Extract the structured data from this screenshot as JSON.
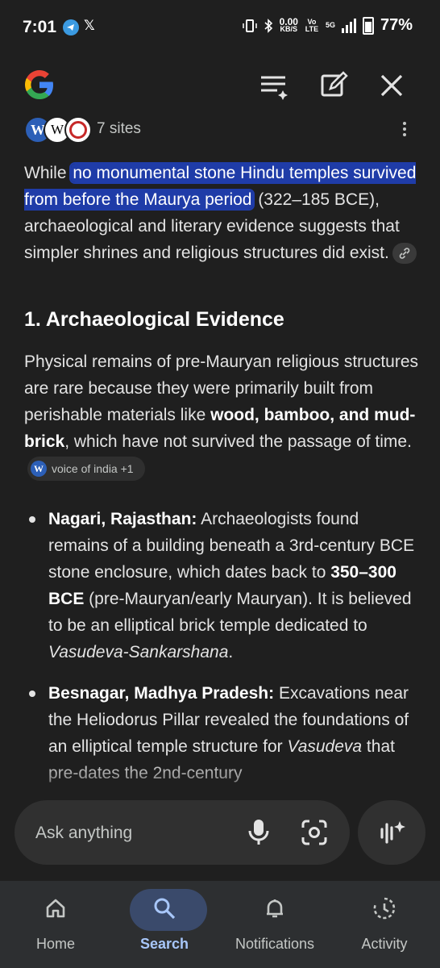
{
  "status_bar": {
    "time": "7:01",
    "network_speed": "0.00",
    "network_unit": "KB/S",
    "volte": "Vo LTE",
    "signal": "5G",
    "battery": "77%"
  },
  "sources": {
    "count_label": "7 sites",
    "favicons": [
      "W",
      "W",
      "ring"
    ]
  },
  "answer": {
    "intro_before": "While ",
    "intro_highlight": "no monumental stone Hindu temples survived from before the Maurya period",
    "intro_after": " (322–185 BCE), archaeological and literary evidence suggests that simpler shrines and religious structures did exist.",
    "section1_heading": "1. Archaeological Evidence",
    "section1_p_before": "Physical remains of pre-Mauryan religious structures are rare because they were primarily built from perishable materials like ",
    "section1_p_bold": "wood, bamboo, and mud-brick",
    "section1_p_after": ", which have not survived the passage of time.",
    "section1_chip": "voice of india +1",
    "bullets": [
      {
        "title": "Nagari, Rajasthan:",
        "t1": " Archaeologists found remains of a building beneath a 3rd-century BCE stone enclosure, which dates back to ",
        "bold": "350–300 BCE",
        "t2": " (pre-Mauryan/early Mauryan). It is believed to be an elliptical brick temple dedicated to ",
        "italic": "Vasudeva-Sankarshana",
        "t3": "."
      },
      {
        "title": "Besnagar, Madhya Pradesh:",
        "t1": " Excavations near the Heliodorus Pillar revealed the foundations of an elliptical temple structure for ",
        "italic": "Vasudeva",
        "t2": " that pre-dates the 2nd-century"
      }
    ]
  },
  "ask_bar": {
    "placeholder": "Ask anything"
  },
  "bottom_nav": {
    "items": [
      {
        "label": "Home",
        "icon": "home-icon"
      },
      {
        "label": "Search",
        "icon": "search-icon"
      },
      {
        "label": "Notifications",
        "icon": "bell-icon"
      },
      {
        "label": "Activity",
        "icon": "activity-icon"
      }
    ],
    "active": "Search"
  },
  "colors": {
    "background": "#1f1f1f",
    "highlight": "#1f3ca8",
    "nav_active": "#a8c7fa"
  }
}
